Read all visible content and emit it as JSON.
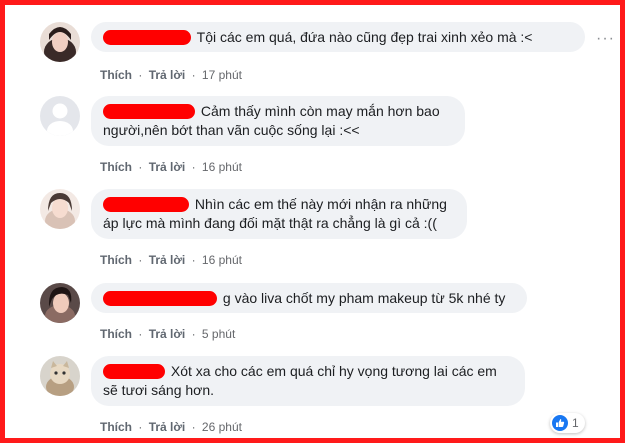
{
  "comments": [
    {
      "text": "Tội các em quá, đứa nào cũng đẹp trai xinh xẻo mà :<",
      "actions": {
        "like": "Thích",
        "reply": "Trả lời",
        "time": "17 phút"
      },
      "more_label": "···"
    },
    {
      "text": "Cảm thấy mình còn may mắn hơn bao người,nên bớt than vãn cuộc sống lại :<<",
      "actions": {
        "like": "Thích",
        "reply": "Trả lời",
        "time": "16 phút"
      }
    },
    {
      "text": "Nhìn các em thế này mới nhận ra những áp lực mà mình đang đối mặt thật ra chẳng là gì cả :((",
      "actions": {
        "like": "Thích",
        "reply": "Trả lời",
        "time": "16 phút"
      }
    },
    {
      "text": "g vào liva chốt my pham makeup từ 5k nhé ty",
      "actions": {
        "like": "Thích",
        "reply": "Trả lời",
        "time": "5 phút"
      }
    },
    {
      "text": "Xót xa cho các em quá chỉ hy vọng tương lai các em sẽ tươi sáng hơn.",
      "actions": {
        "like": "Thích",
        "reply": "Trả lời",
        "time": "26 phút"
      },
      "reaction": {
        "icon": "like-icon",
        "count": "1",
        "color": "#1877f2"
      }
    }
  ],
  "separator": "·",
  "colors": {
    "frame": "#ff1a1a",
    "redaction": "#ff0000",
    "bubble": "#f0f2f5"
  }
}
